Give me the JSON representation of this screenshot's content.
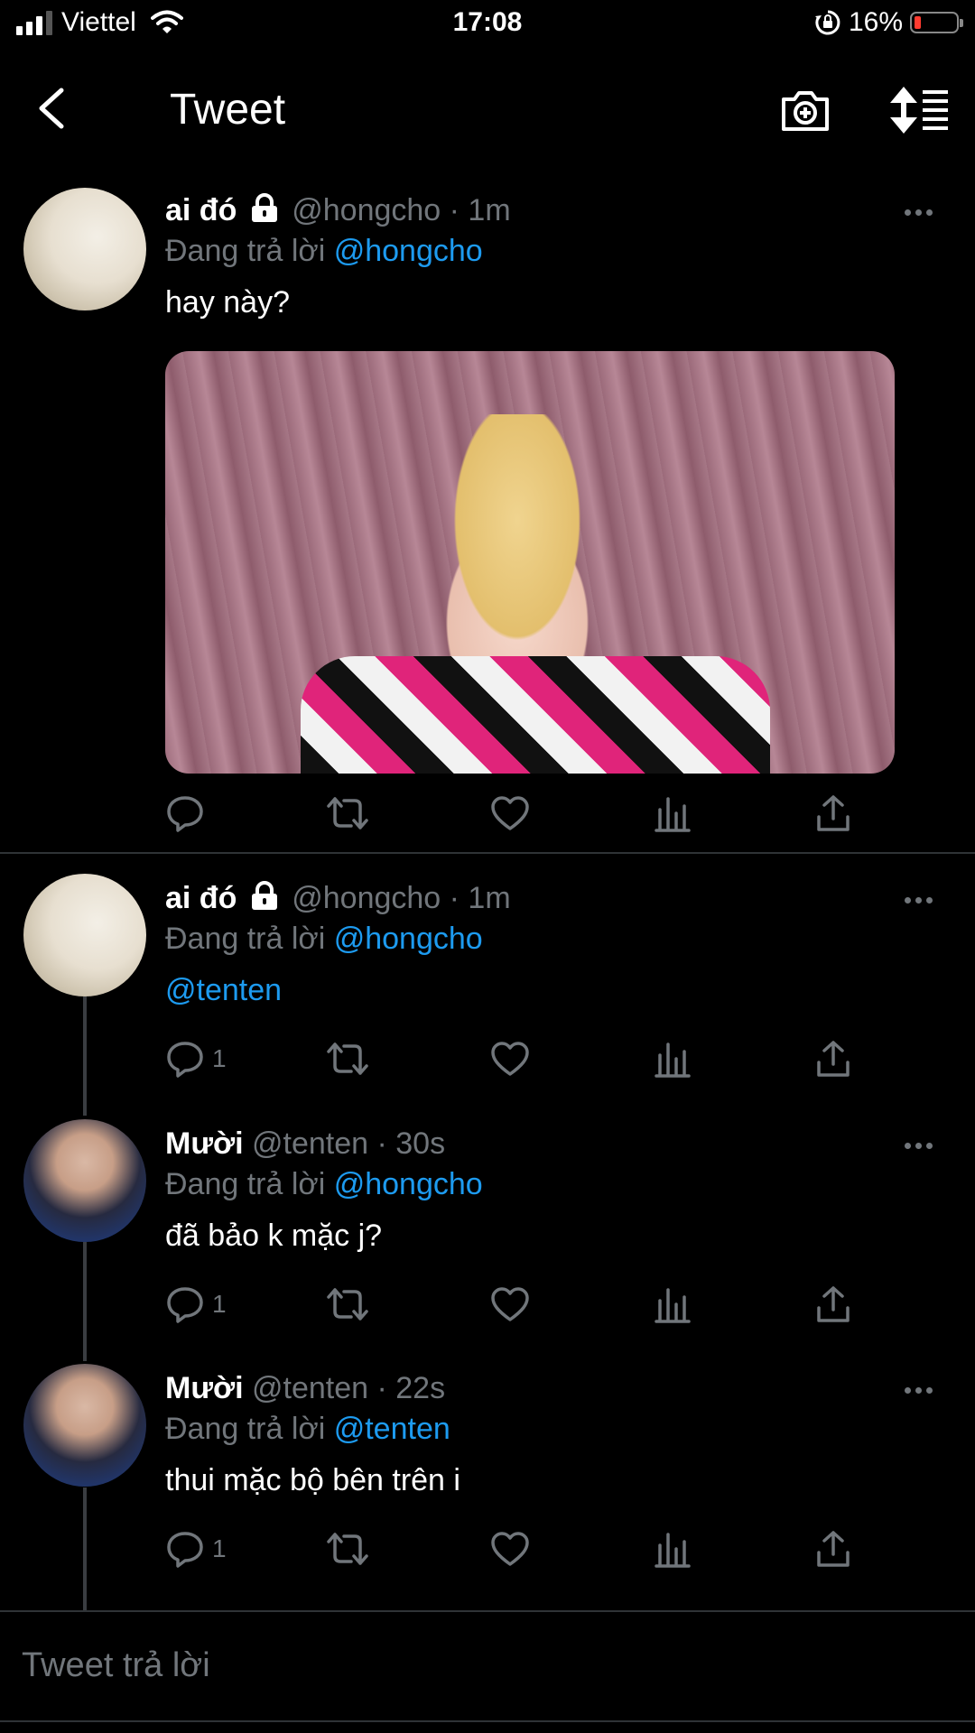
{
  "status_bar": {
    "carrier": "Viettel",
    "time": "17:08",
    "battery_percent": "16%",
    "battery_level": 0.16,
    "battery_color": "#ff3b30",
    "icons": [
      "signal-icon",
      "wifi-icon",
      "orientation-lock-icon",
      "battery-icon"
    ]
  },
  "header": {
    "title": "Tweet",
    "icons": [
      "back-arrow-icon",
      "camera-plus-icon",
      "sort-icon"
    ]
  },
  "colors": {
    "background": "#000000",
    "link": "#1d9bf0",
    "muted": "#71767b",
    "divider": "#2f3336"
  },
  "tweets": [
    {
      "name": "ai đó",
      "locked": true,
      "meta": "@hongcho · 1m",
      "reply_prefix": "Đang trả lời",
      "reply_to": "@hongcho",
      "text": "hay này?",
      "has_media": true,
      "reply_count": ""
    },
    {
      "name": "ai đó",
      "locked": true,
      "meta": "@hongcho · 1m",
      "reply_prefix": "Đang trả lời",
      "reply_to": "@hongcho",
      "text": "@tenten",
      "has_media": false,
      "reply_count": "1"
    },
    {
      "name": "Mười",
      "locked": false,
      "meta": "@tenten · 30s",
      "reply_prefix": "Đang trả lời",
      "reply_to": "@hongcho",
      "text": "đã bảo k mặc j?",
      "has_media": false,
      "reply_count": "1"
    },
    {
      "name": "Mười",
      "locked": false,
      "meta": "@tenten · 22s",
      "reply_prefix": "Đang trả lời",
      "reply_to": "@tenten",
      "text": "thui mặc bộ bên trên i",
      "has_media": false,
      "reply_count": "1"
    }
  ],
  "reply_bar": {
    "placeholder": "Tweet trả lời"
  }
}
